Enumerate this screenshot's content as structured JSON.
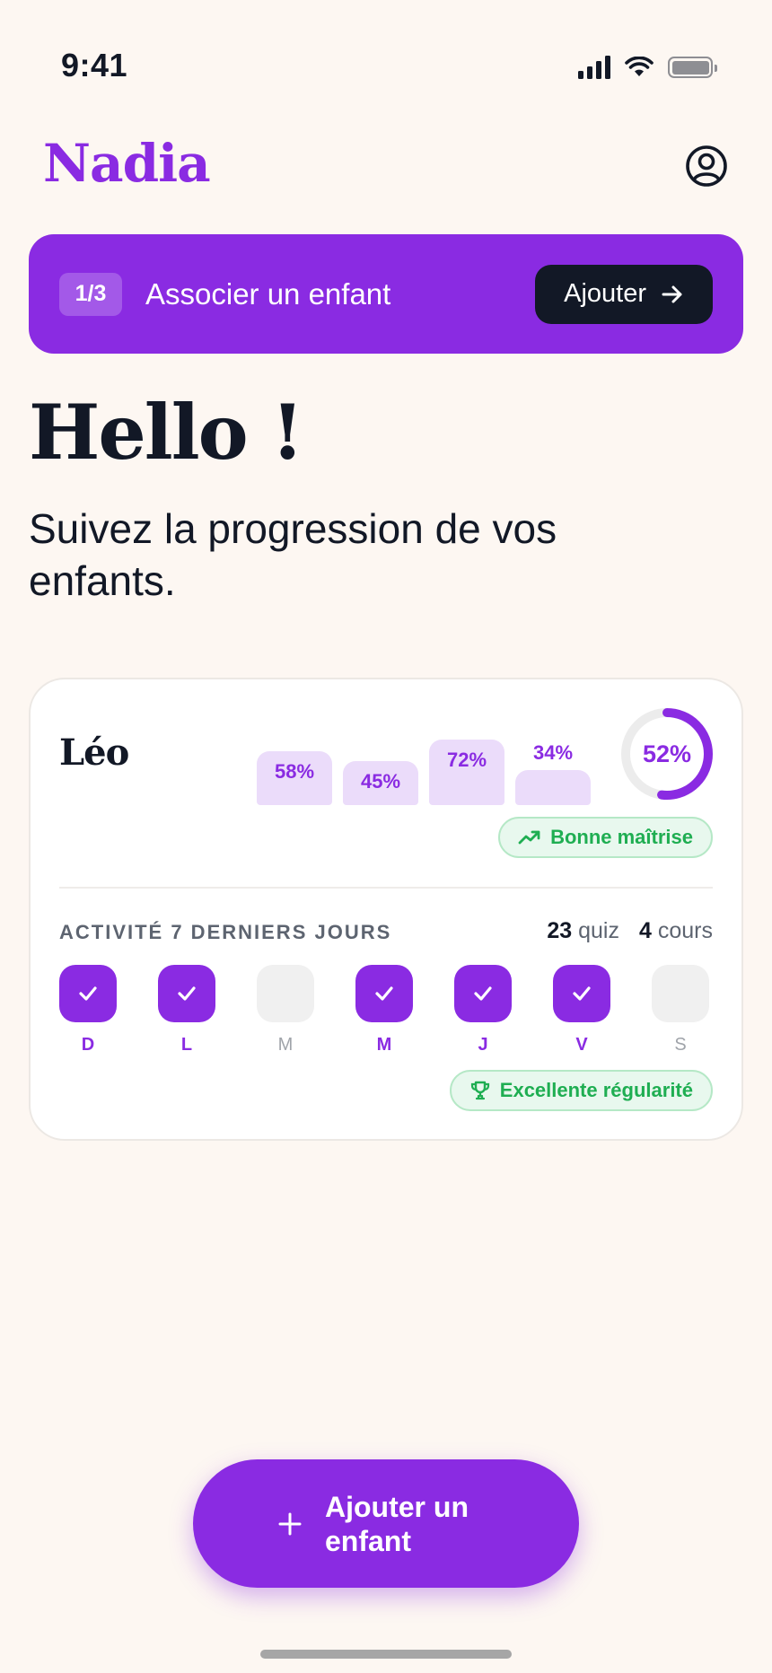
{
  "status_bar": {
    "time": "9:41"
  },
  "header": {
    "brand": "Nadia",
    "profile_icon": "user-circle-icon"
  },
  "banner": {
    "step": "1/3",
    "text": "Associer un enfant",
    "button_label": "Ajouter"
  },
  "hero": {
    "title": "Hello !",
    "subtitle": "Suivez la progression de vos enfants."
  },
  "child_card": {
    "name": "Léo",
    "subject_bars": [
      {
        "label": "58%",
        "value": 58
      },
      {
        "label": "45%",
        "value": 45
      },
      {
        "label": "72%",
        "value": 72
      },
      {
        "label": "34%",
        "value": 34
      }
    ],
    "overall": {
      "label": "52%",
      "value": 52
    },
    "mastery_badge": "Bonne maîtrise",
    "activity_title": "ACTIVITÉ 7 DERNIERS JOURS",
    "stats": {
      "quiz_count": "23",
      "quiz_label": "quiz",
      "course_count": "4",
      "course_label": "cours"
    },
    "days": [
      {
        "letter": "D",
        "active": true
      },
      {
        "letter": "L",
        "active": true
      },
      {
        "letter": "M",
        "active": false
      },
      {
        "letter": "M",
        "active": true
      },
      {
        "letter": "J",
        "active": true
      },
      {
        "letter": "V",
        "active": true
      },
      {
        "letter": "S",
        "active": false
      }
    ],
    "regularity_badge": "Excellente régularité"
  },
  "fab": {
    "label": "Ajouter un enfant"
  },
  "colors": {
    "accent": "#8a2be2",
    "bar_fill": "#ebdcfa",
    "success": "#1fae52",
    "success_bg": "#e8f8ee",
    "dark": "#121826",
    "background": "#fdf7f2"
  }
}
